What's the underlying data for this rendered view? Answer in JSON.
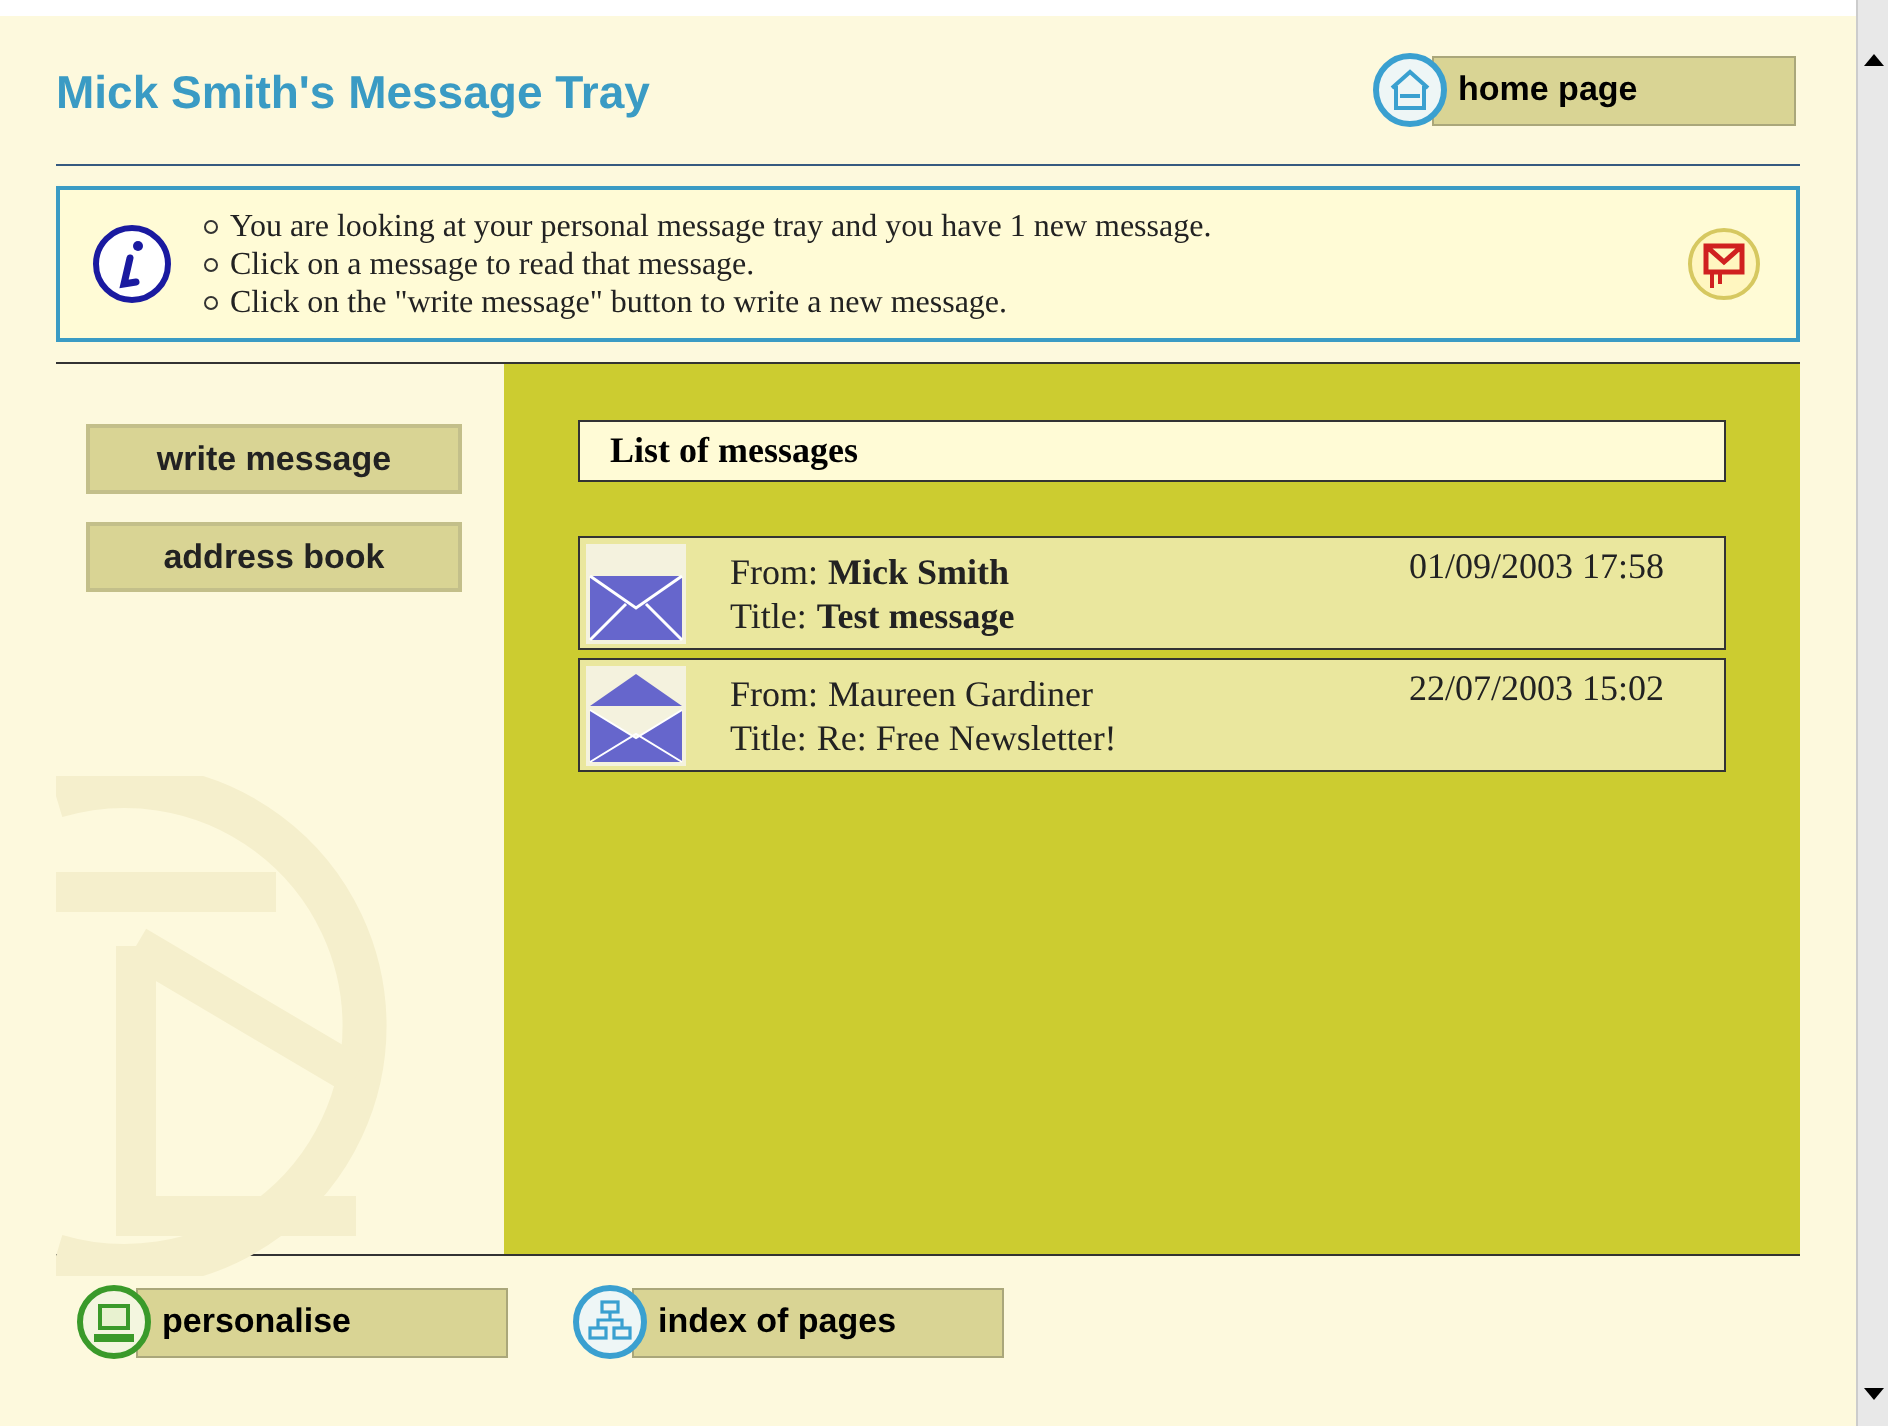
{
  "header": {
    "title": "Mick Smith's Message Tray",
    "home_button": "home page"
  },
  "info": {
    "lines": [
      "You are looking at your personal message tray and you have 1 new message.",
      "Click on a message to read that message.",
      "Click on the \"write message\" button to write a new message."
    ]
  },
  "sidebar": {
    "buttons": [
      "write message",
      "address book"
    ]
  },
  "messages": {
    "heading": "List of messages",
    "items": [
      {
        "from_label": "From:",
        "from": "Mick Smith",
        "title_label": "Title:",
        "title": "Test message",
        "date": "01/09/2003 17:58",
        "unread": true
      },
      {
        "from_label": "From:",
        "from": "Maureen Gardiner",
        "title_label": "Title:",
        "title": "Re: Free Newsletter!",
        "date": "22/07/2003 15:02",
        "unread": false
      }
    ]
  },
  "footer": {
    "buttons": [
      {
        "label": "personalise",
        "kind": "computer"
      },
      {
        "label": "index of pages",
        "kind": "sitemap"
      }
    ]
  }
}
